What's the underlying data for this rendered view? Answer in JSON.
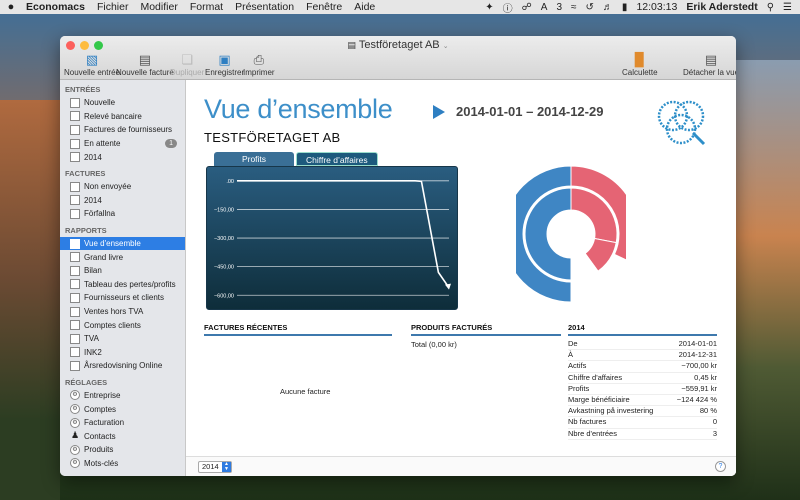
{
  "menubar": {
    "apple": "",
    "app_name": "Economacs",
    "items": [
      "Fichier",
      "Modifier",
      "Format",
      "Présentation",
      "Fenêtre",
      "Aide"
    ],
    "time": "12:03:13",
    "user": "Erik Aderstedt",
    "badge_count": "3"
  },
  "window": {
    "title": "Testföretaget AB"
  },
  "toolbar": {
    "new_entry": "Nouvelle entrée",
    "new_invoice": "Nouvelle facture",
    "duplicate": "Dupliquer",
    "save": "Enregistrer",
    "print": "Imprimer",
    "calculator": "Calculette",
    "detach": "Détacher la vue"
  },
  "sidebar": {
    "sections": [
      {
        "title": "ENTRÉES",
        "items": [
          {
            "label": "Nouvelle"
          },
          {
            "label": "Relevé bancaire"
          },
          {
            "label": "Factures de fournisseurs"
          },
          {
            "label": "En attente",
            "badge": "1"
          },
          {
            "label": "2014"
          }
        ]
      },
      {
        "title": "FACTURES",
        "items": [
          {
            "label": "Non envoyée"
          },
          {
            "label": "2014"
          },
          {
            "label": "Förfallna"
          }
        ]
      },
      {
        "title": "RAPPORTS",
        "items": [
          {
            "label": "Vue d'ensemble"
          },
          {
            "label": "Grand livre"
          },
          {
            "label": "Bilan"
          },
          {
            "label": "Tableau des pertes/profits"
          },
          {
            "label": "Fournisseurs et clients"
          },
          {
            "label": "Ventes hors TVA"
          },
          {
            "label": "Comptes clients"
          },
          {
            "label": "TVA"
          },
          {
            "label": "INK2"
          },
          {
            "label": "Årsredovisning Online"
          }
        ]
      },
      {
        "title": "RÉGLAGES",
        "items": [
          {
            "label": "Entreprise"
          },
          {
            "label": "Comptes"
          },
          {
            "label": "Facturation"
          },
          {
            "label": "Contacts"
          },
          {
            "label": "Produits"
          },
          {
            "label": "Mots-clés"
          }
        ]
      }
    ]
  },
  "main": {
    "title": "Vue d’ensemble",
    "date_range": "2014-01-01 – 2014-12-29",
    "company": "TESTFÖRETAGET AB",
    "tabs": [
      "Profits",
      "Chiffre d’affaires"
    ],
    "recent_invoices_header": "FACTURES RÉCENTES",
    "recent_invoices_empty": "Aucune facture",
    "products_header": "PRODUITS FACTURÉS",
    "products_total": "Total (0,00 kr)",
    "stats_header": "2014",
    "stats": [
      {
        "label": "De",
        "value": "2014-01-01"
      },
      {
        "label": "À",
        "value": "2014-12-31"
      },
      {
        "label": "Actifs",
        "value": "−700,00 kr"
      },
      {
        "label": "Chiffre d'affaires",
        "value": "0,45 kr"
      },
      {
        "label": "Profits",
        "value": "−559,91 kr"
      },
      {
        "label": "Marge bénéficiaire",
        "value": "−124 424 %"
      },
      {
        "label": "Avkastning på investering",
        "value": "80 %"
      },
      {
        "label": "Nb factures",
        "value": "0"
      },
      {
        "label": "Nbre d'entrées",
        "value": "3"
      }
    ]
  },
  "footer": {
    "year": "2014",
    "help": "?"
  },
  "chart_data": [
    {
      "type": "line",
      "title": "Profits",
      "ytick_labels": [
        ".00",
        "−150,00",
        "−300,00",
        "−450,00",
        "−600,00"
      ],
      "yticks": [
        0,
        -150,
        -300,
        -450,
        -600
      ],
      "ylim": [
        -630,
        20
      ],
      "x": [
        0,
        0.84,
        0.87,
        0.95,
        1.0
      ],
      "values": [
        0,
        0,
        -3,
        -480,
        -560
      ],
      "line_color": "#ffffff"
    },
    {
      "type": "pie",
      "style": "concentric-donut",
      "rings": [
        {
          "name": "outer",
          "slices": [
            {
              "value": 50,
              "color": "#3f86c4"
            },
            {
              "value": 32,
              "color": "#e56474"
            },
            {
              "value": 18,
              "color": "#ffffff"
            }
          ]
        },
        {
          "name": "middle",
          "slices": [
            {
              "value": 50,
              "color": "#3f86c4"
            },
            {
              "value": 28,
              "color": "#e56474"
            },
            {
              "value": 12,
              "color": "#e56474"
            },
            {
              "value": 10,
              "color": "#ffffff"
            }
          ]
        }
      ]
    }
  ]
}
